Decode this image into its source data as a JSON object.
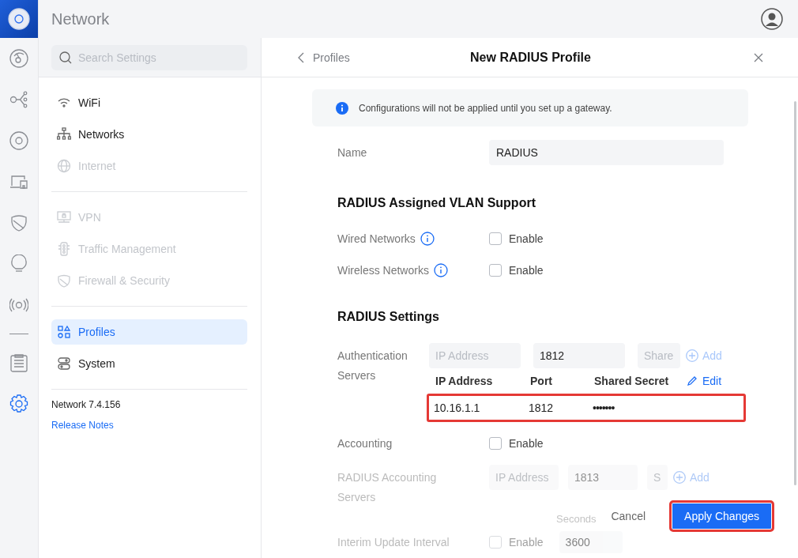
{
  "app": {
    "title": "Network"
  },
  "rail": [
    {
      "kind": "dashboard",
      "selected": false
    },
    {
      "kind": "topology",
      "selected": false
    },
    {
      "kind": "target",
      "selected": false
    },
    {
      "kind": "devices",
      "selected": false
    },
    {
      "kind": "shield",
      "selected": false
    },
    {
      "kind": "bulb",
      "selected": false
    },
    {
      "kind": "radio",
      "selected": false
    },
    {
      "kind": "divider",
      "selected": false
    },
    {
      "kind": "logs",
      "selected": false
    },
    {
      "kind": "settings",
      "selected": true
    }
  ],
  "search": {
    "placeholder": "Search Settings"
  },
  "nav_groups": [
    [
      {
        "kind": "wifi",
        "label": "WiFi",
        "disabled": false,
        "selected": false
      },
      {
        "kind": "networks",
        "label": "Networks",
        "disabled": false,
        "selected": false
      },
      {
        "kind": "internet",
        "label": "Internet",
        "disabled": true,
        "selected": false
      }
    ],
    [
      {
        "kind": "vpn",
        "label": "VPN",
        "disabled": true,
        "selected": false
      },
      {
        "kind": "traffic",
        "label": "Traffic Management",
        "disabled": true,
        "selected": false
      },
      {
        "kind": "firewall",
        "label": "Firewall & Security",
        "disabled": true,
        "selected": false
      }
    ],
    [
      {
        "kind": "profiles",
        "label": "Profiles",
        "disabled": false,
        "selected": true
      },
      {
        "kind": "system",
        "label": "System",
        "disabled": false,
        "selected": false
      }
    ]
  ],
  "version": "Network 7.4.156",
  "release_notes": "Release Notes",
  "panel": {
    "back": "Profiles",
    "title": "New RADIUS Profile",
    "notice": "Configurations will not be applied until you set up a gateway.",
    "name": {
      "label": "Name",
      "value": "RADIUS"
    },
    "vlan": {
      "title": "RADIUS Assigned VLAN Support",
      "rows": [
        {
          "label": "Wired Networks",
          "checkbox": "Enable",
          "checked": false
        },
        {
          "label": "Wireless Networks",
          "checkbox": "Enable",
          "checked": false
        }
      ]
    },
    "radius": {
      "title": "RADIUS Settings",
      "auth": {
        "label": "Authentication Servers",
        "ip_placeholder": "IP Address",
        "port": "1812",
        "secret_placeholder": "Share",
        "add": "Add",
        "disabled": false,
        "columns": [
          "IP Address",
          "Port",
          "Shared Secret"
        ],
        "edit": "Edit",
        "rows": [
          {
            "ip": "10.16.1.1",
            "port": "1812",
            "secret": "•••••••",
            "highlighted": true
          }
        ]
      },
      "accounting": {
        "label": "Accounting",
        "checkbox": "Enable",
        "checked": false
      },
      "acct_servers": {
        "label": "RADIUS Accounting Servers",
        "ip_placeholder": "IP Address",
        "port": "1813",
        "secret_placeholder": "S",
        "add": "Add",
        "disabled": true
      },
      "interim": {
        "label": "Interim Update Interval",
        "checkbox": "Enable",
        "checked": false,
        "unit": "Seconds",
        "value": "3600",
        "disabled": true
      }
    }
  },
  "footer": {
    "cancel": "Cancel",
    "apply": {
      "label": "Apply Changes",
      "highlighted": true
    }
  }
}
